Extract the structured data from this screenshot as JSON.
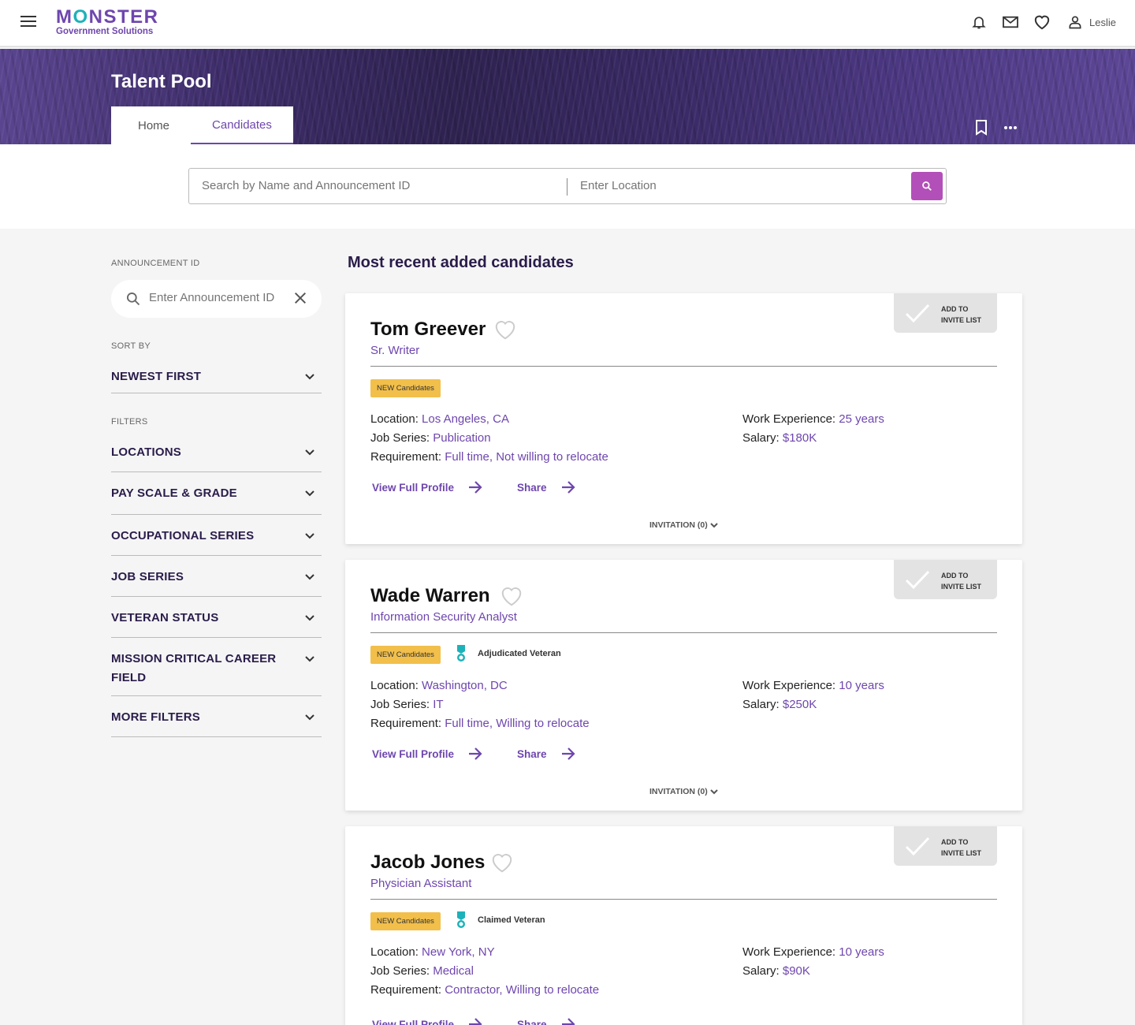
{
  "header": {
    "logo_main": "MONSTER",
    "logo_sub": "Government Solutions",
    "user_name": "Leslie"
  },
  "hero": {
    "title": "Talent Pool",
    "tabs": [
      {
        "label": "Home",
        "active": false
      },
      {
        "label": "Candidates",
        "active": true
      }
    ]
  },
  "search": {
    "name_placeholder": "Search by Name and Announcement ID",
    "location_placeholder": "Enter Location"
  },
  "sidebar": {
    "announcement_label": "ANNOUNCEMENT ID",
    "announcement_placeholder": "Enter Announcement ID",
    "sort_label": "SORT BY",
    "sort_value": "NEWEST FIRST",
    "filters_label": "FILTERS",
    "filters": [
      "LOCATIONS",
      "PAY SCALE & GRADE",
      "OCCUPATIONAL SERIES",
      "JOB SERIES",
      "VETERAN STATUS",
      "MISSION CRITICAL CAREER FIELD",
      "MORE FILTERS"
    ]
  },
  "main": {
    "title": "Most recent added candidates",
    "invite_label_1": "ADD TO",
    "invite_label_2": "INVITE LIST",
    "badge_new": "NEW Candidates",
    "labels": {
      "location": "Location: ",
      "job_series": "Job Series: ",
      "requirement": "Requirement: ",
      "work_experience": "Work Experience: ",
      "salary": "Salary: "
    },
    "view_profile": "View Full Profile",
    "share": "Share",
    "invitation": "INVITATION (0)",
    "candidates": [
      {
        "name": "Tom Greever",
        "title": "Sr. Writer",
        "veteran": "",
        "location": "Los Angeles, CA",
        "job_series": "Publication",
        "requirement": "Full time, Not willing to relocate",
        "work_experience": "25 years",
        "salary": "$180K"
      },
      {
        "name": "Wade Warren",
        "title": "Information Security Analyst",
        "veteran": "Adjudicated Veteran",
        "location": "Washington, DC",
        "job_series": "IT",
        "requirement": "Full time, Willing to relocate",
        "work_experience": "10 years",
        "salary": "$250K"
      },
      {
        "name": "Jacob Jones",
        "title": "Physician Assistant",
        "veteran": "Claimed Veteran",
        "location": "New York, NY",
        "job_series": "Medical",
        "requirement": "Contractor, Willing to relocate",
        "work_experience": "10 years",
        "salary": "$90K"
      }
    ]
  },
  "colors": {
    "brand_purple": "#6e46ae",
    "brand_teal": "#1db2b9",
    "search_button": "#b34fb8",
    "badge_yellow": "#f2bf4b",
    "navy_text": "#2a1c4a"
  },
  "icons": [
    "menu-icon",
    "bell-icon",
    "mail-icon",
    "heart-icon",
    "user-icon",
    "bookmark-icon",
    "more-icon",
    "search-icon",
    "close-icon",
    "chevron-down-icon",
    "check-icon",
    "medal-icon",
    "arrow-right-icon"
  ]
}
